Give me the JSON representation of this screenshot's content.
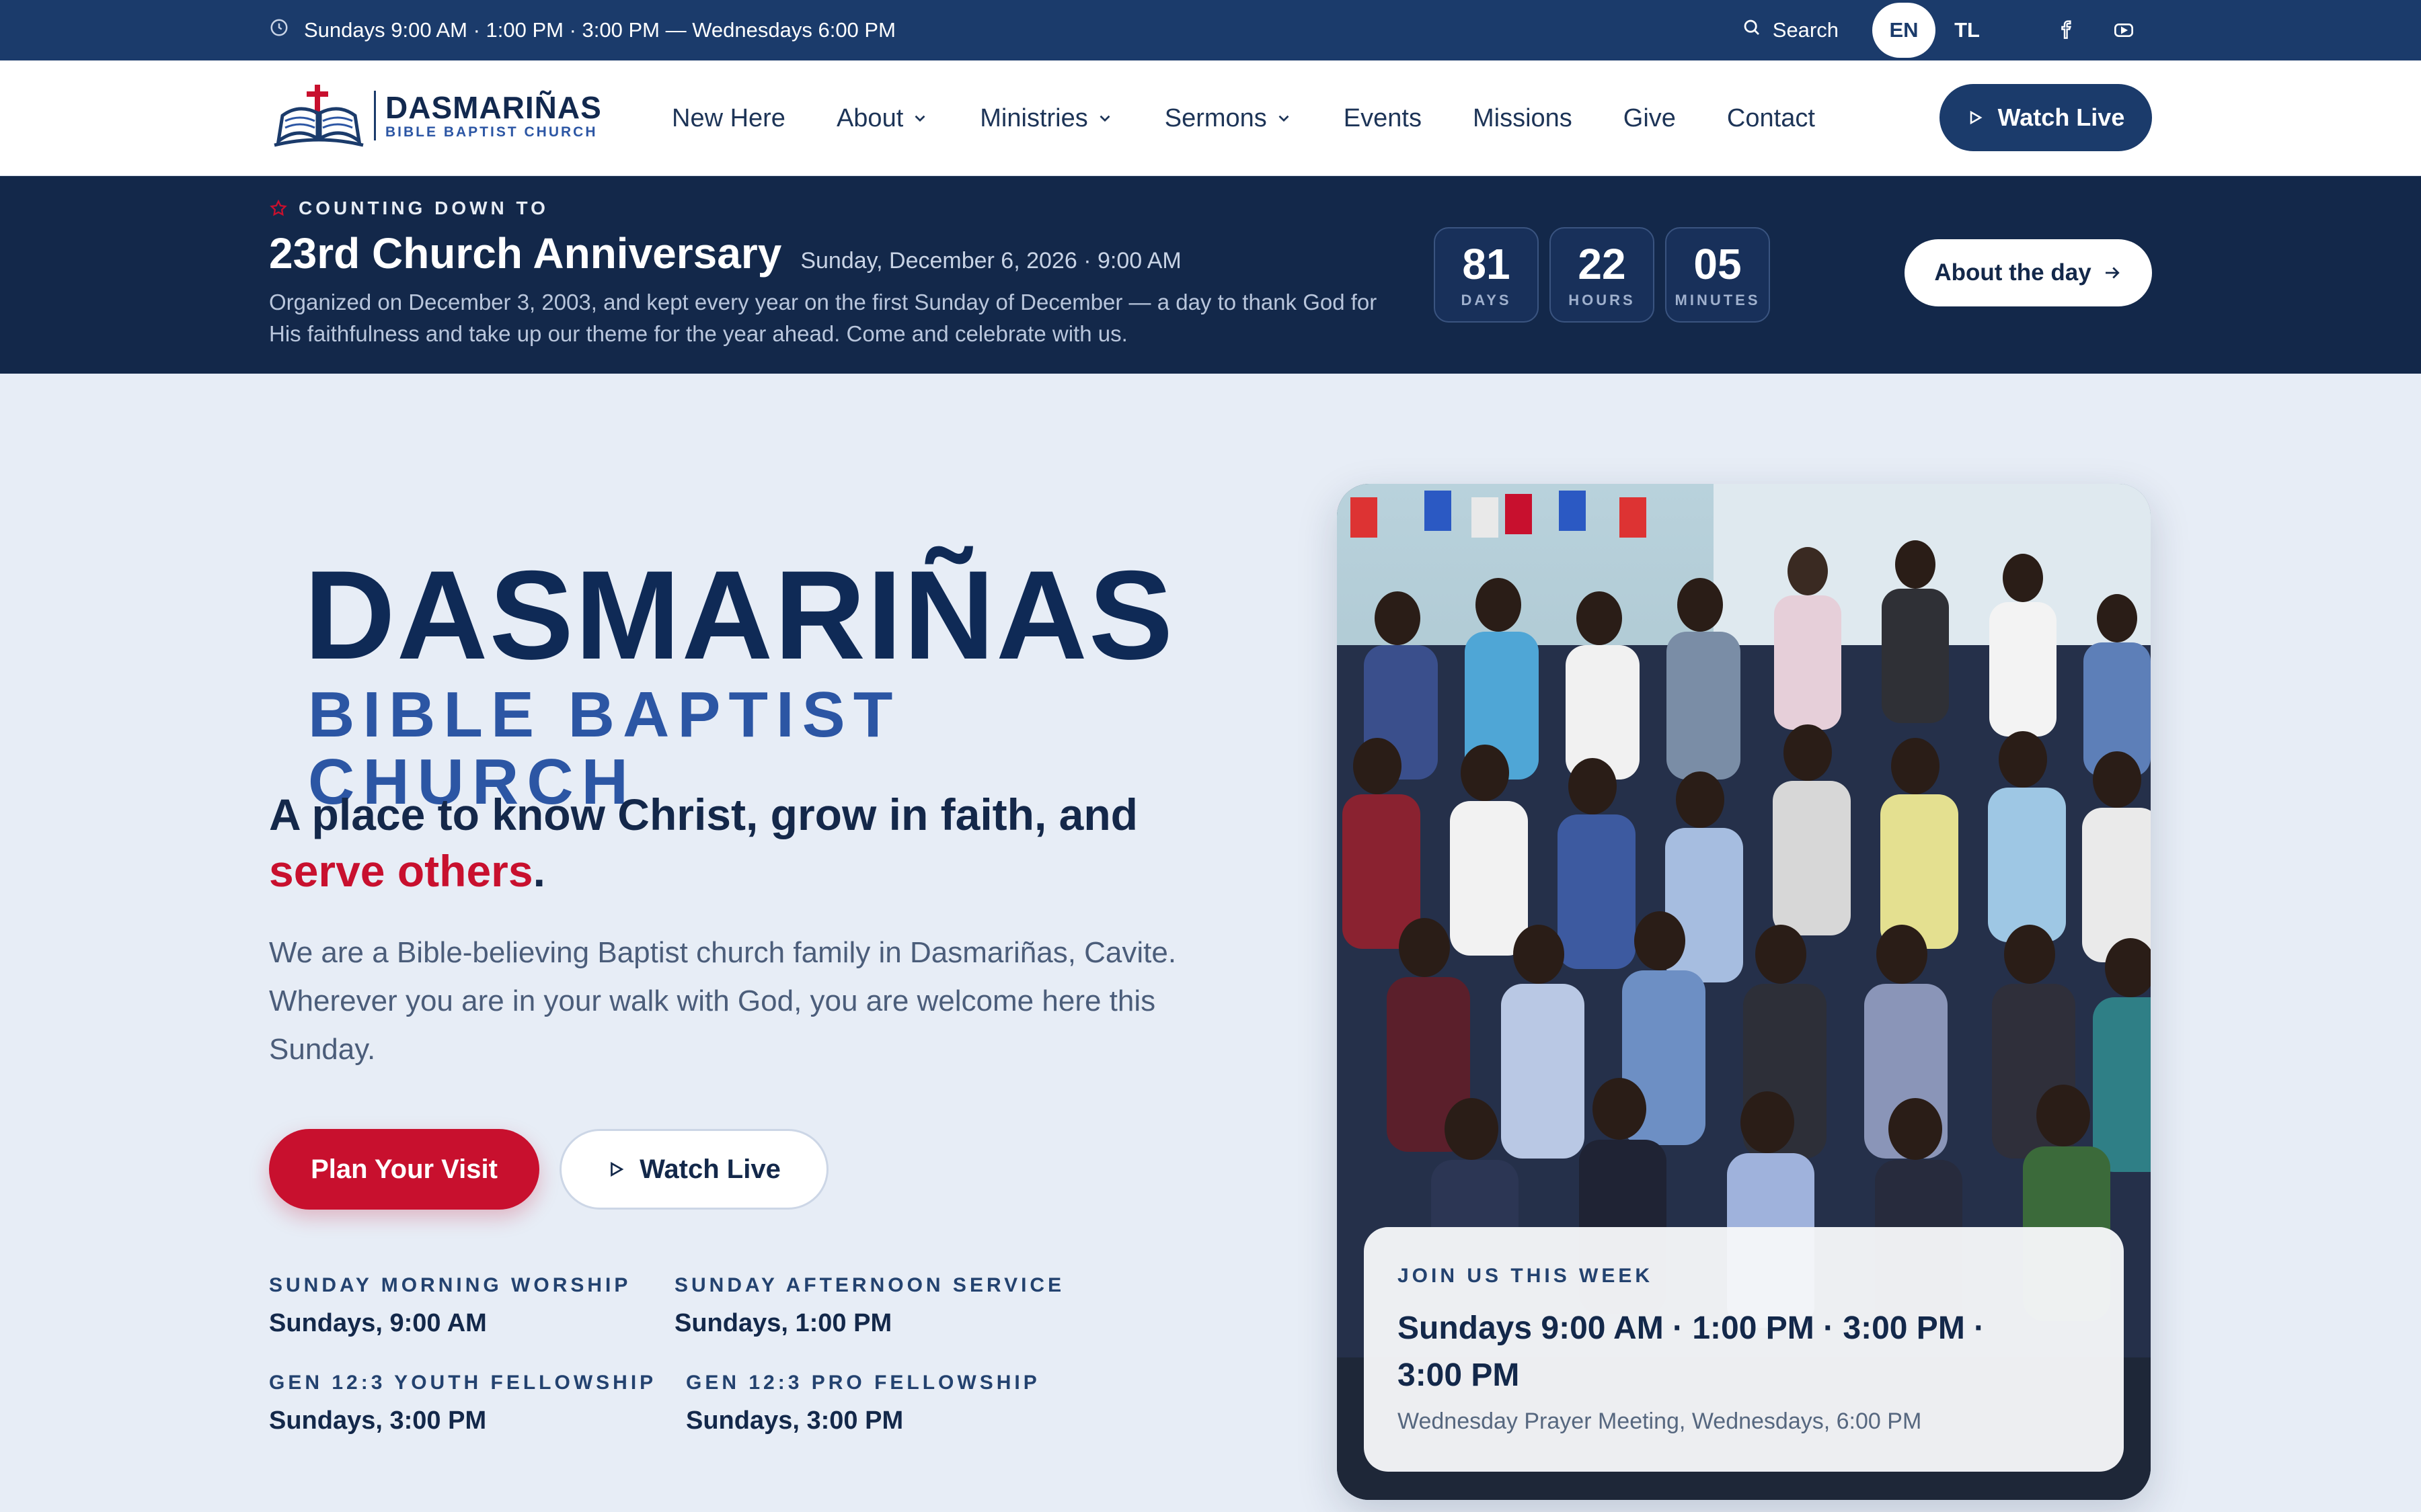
{
  "topbar": {
    "hours_text": "Sundays 9:00 AM · 1:00 PM · 3:00 PM — Wednesdays 6:00 PM",
    "search_label": "Search",
    "lang_en": "EN",
    "lang_tl": "TL",
    "icons": [
      "clock-icon",
      "search-icon",
      "facebook-icon",
      "youtube-icon"
    ]
  },
  "header": {
    "logo_name": "DASMARIÑAS",
    "logo_sub": "BIBLE BAPTIST CHURCH",
    "nav": [
      {
        "label": "New Here",
        "dropdown": false
      },
      {
        "label": "About",
        "dropdown": true
      },
      {
        "label": "Ministries",
        "dropdown": true
      },
      {
        "label": "Sermons",
        "dropdown": true
      },
      {
        "label": "Events",
        "dropdown": false
      },
      {
        "label": "Missions",
        "dropdown": false
      },
      {
        "label": "Give",
        "dropdown": false
      },
      {
        "label": "Contact",
        "dropdown": false
      }
    ],
    "watch_live": "Watch Live"
  },
  "banner": {
    "eyebrow": "COUNTING DOWN TO",
    "title": "23rd Church Anniversary",
    "date": "Sunday, December 6, 2026 · 9:00 AM",
    "description": "Organized on December 3, 2003, and kept every year on the first Sunday of December — a day to thank God for His faithfulness and take up our theme for the year ahead. Come and celebrate with us.",
    "countdown": [
      {
        "value": "81",
        "label": "DAYS"
      },
      {
        "value": "22",
        "label": "HOURS"
      },
      {
        "value": "05",
        "label": "MINUTES"
      }
    ],
    "about_button": "About the day"
  },
  "hero": {
    "brand_name": "DASMARIÑAS",
    "brand_sub": "BIBLE BAPTIST CHURCH",
    "tagline_main": "A place to know Christ, grow in faith, and ",
    "tagline_accent": "serve others",
    "tagline_end": ".",
    "intro": "We are a Bible-believing Baptist church family in Dasmariñas, Cavite. Wherever you are in your walk with God, you are welcome here this Sunday.",
    "plan_visit": "Plan Your Visit",
    "watch_live": "Watch Live",
    "services": [
      {
        "label": "SUNDAY MORNING WORSHIP",
        "time": "Sundays, 9:00 AM"
      },
      {
        "label": "SUNDAY AFTERNOON SERVICE",
        "time": "Sundays, 1:00 PM"
      },
      {
        "label": "GEN 12:3 YOUTH FELLOWSHIP",
        "time": "Sundays, 3:00 PM"
      },
      {
        "label": "GEN 12:3 PRO FELLOWSHIP",
        "time": "Sundays, 3:00 PM"
      }
    ]
  },
  "photo_card": {
    "eyebrow": "JOIN US THIS WEEK",
    "times": "Sundays 9:00 AM · 1:00 PM · 3:00 PM · 3:00 PM",
    "note": "Wednesday Prayer Meeting, Wednesdays, 6:00 PM"
  },
  "colors": {
    "navy": "#1b3b6b",
    "banner_navy": "#13284a",
    "accent_red": "#c8102e",
    "brand_blue": "#2c56a4",
    "page_bg": "#e7edf6"
  }
}
